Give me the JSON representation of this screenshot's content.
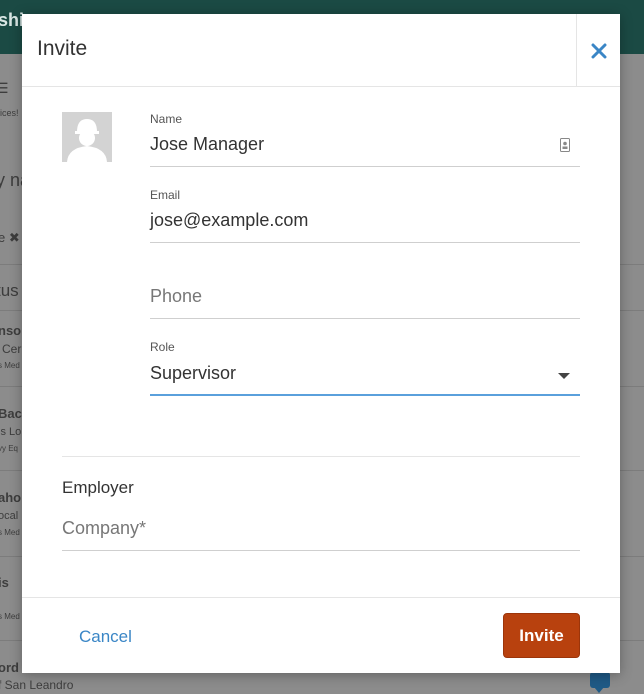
{
  "background": {
    "brand_fragment": "ship",
    "left_fragments": [
      "ices!",
      "y na",
      "e ✖",
      "tus",
      "nso",
      "Cer",
      "s Med",
      "Baci",
      "ls Lo",
      "vy Eq",
      "aho",
      "ocal",
      "s Med",
      "is",
      "s Med",
      "ord",
      "f San Leandro"
    ]
  },
  "modal": {
    "title": "Invite",
    "close_icon": "close-icon",
    "avatar_icon": "user-silhouette-icon",
    "fields": {
      "name": {
        "label": "Name",
        "value": "Jose Manager",
        "icon": "contact-card-icon"
      },
      "email": {
        "label": "Email",
        "value": "jose@example.com"
      },
      "phone": {
        "placeholder": "Phone"
      },
      "role": {
        "label": "Role",
        "value": "Supervisor",
        "icon": "chevron-down-icon"
      }
    },
    "employer": {
      "title": "Employer",
      "company_placeholder": "Company*"
    },
    "footer": {
      "cancel_label": "Cancel",
      "invite_label": "Invite"
    }
  },
  "colors": {
    "accent": "#3a86c6",
    "primary_button": "#b8410e",
    "active_underline": "#5aa0dc",
    "topbar": "#1b4a44"
  }
}
